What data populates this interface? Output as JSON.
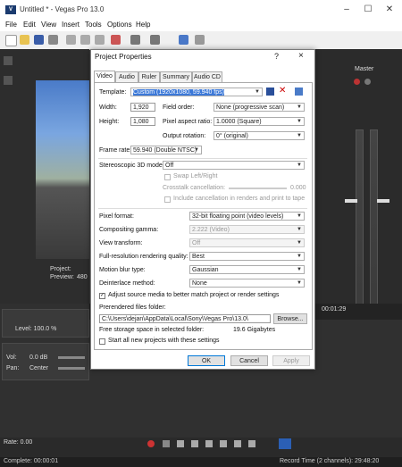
{
  "window": {
    "title": "Untitled * - Vegas Pro 13.0"
  },
  "menu": [
    "File",
    "Edit",
    "View",
    "Insert",
    "Tools",
    "Options",
    "Help"
  ],
  "preview": {
    "project_label": "Project:",
    "preview_label": "Preview:",
    "preview_value": "480"
  },
  "master": {
    "label": "Master"
  },
  "tracks": {
    "level_label": "Level: 100.0 %",
    "vol_label": "Vol:",
    "vol_value": "0.0 dB",
    "pan_label": "Pan:",
    "pan_value": "Center",
    "ruler_time": "00:01:29"
  },
  "transport": {
    "rate_label": "Rate: 0.00"
  },
  "status": {
    "complete": "Complete: 00:00:01",
    "record_time": "Record Time (2 channels): 29:48:20"
  },
  "dialog": {
    "title": "Project Properties",
    "help": "?",
    "close": "×",
    "tabs": [
      "Video",
      "Audio",
      "Ruler",
      "Summary",
      "Audio CD"
    ],
    "active_tab": "Video",
    "template_label": "Template:",
    "template_value": "Custom (1920x1080, 59.940 fps)",
    "width_label": "Width:",
    "width_value": "1,920",
    "height_label": "Height:",
    "height_value": "1,080",
    "field_order_label": "Field order:",
    "field_order_value": "None (progressive scan)",
    "pixel_aspect_label": "Pixel aspect ratio:",
    "pixel_aspect_value": "1.0000 (Square)",
    "output_rotation_label": "Output rotation:",
    "output_rotation_value": "0° (original)",
    "frame_rate_label": "Frame rate:",
    "frame_rate_value": "59.940 (Double NTSC)",
    "stereo_label": "Stereoscopic 3D mode:",
    "stereo_value": "Off",
    "swap_label": "Swap Left/Right",
    "crosstalk_label": "Crosstalk cancellation:",
    "crosstalk_value": "0.000",
    "include_cancel_label": "Include cancellation in renders and print to tape",
    "pixel_format_label": "Pixel format:",
    "pixel_format_value": "32-bit floating point (video levels)",
    "gamma_label": "Compositing gamma:",
    "gamma_value": "2.222 (Video)",
    "view_transform_label": "View transform:",
    "view_transform_value": "Off",
    "render_quality_label": "Full-resolution rendering quality:",
    "render_quality_value": "Best",
    "motion_blur_label": "Motion blur type:",
    "motion_blur_value": "Gaussian",
    "deinterlace_label": "Deinterlace method:",
    "deinterlace_value": "None",
    "adjust_source_label": "Adjust source media to better match project or render settings",
    "prerender_label": "Prerendered files folder:",
    "prerender_path": "C:\\Users\\dejan\\AppData\\Local\\Sony\\Vegas Pro\\13.0\\",
    "browse_label": "Browse...",
    "free_storage_label": "Free storage space in selected folder:",
    "free_storage_value": "19.6 Gigabytes",
    "start_all_label": "Start all new projects with these settings",
    "ok_label": "OK",
    "cancel_label": "Cancel",
    "apply_label": "Apply"
  }
}
